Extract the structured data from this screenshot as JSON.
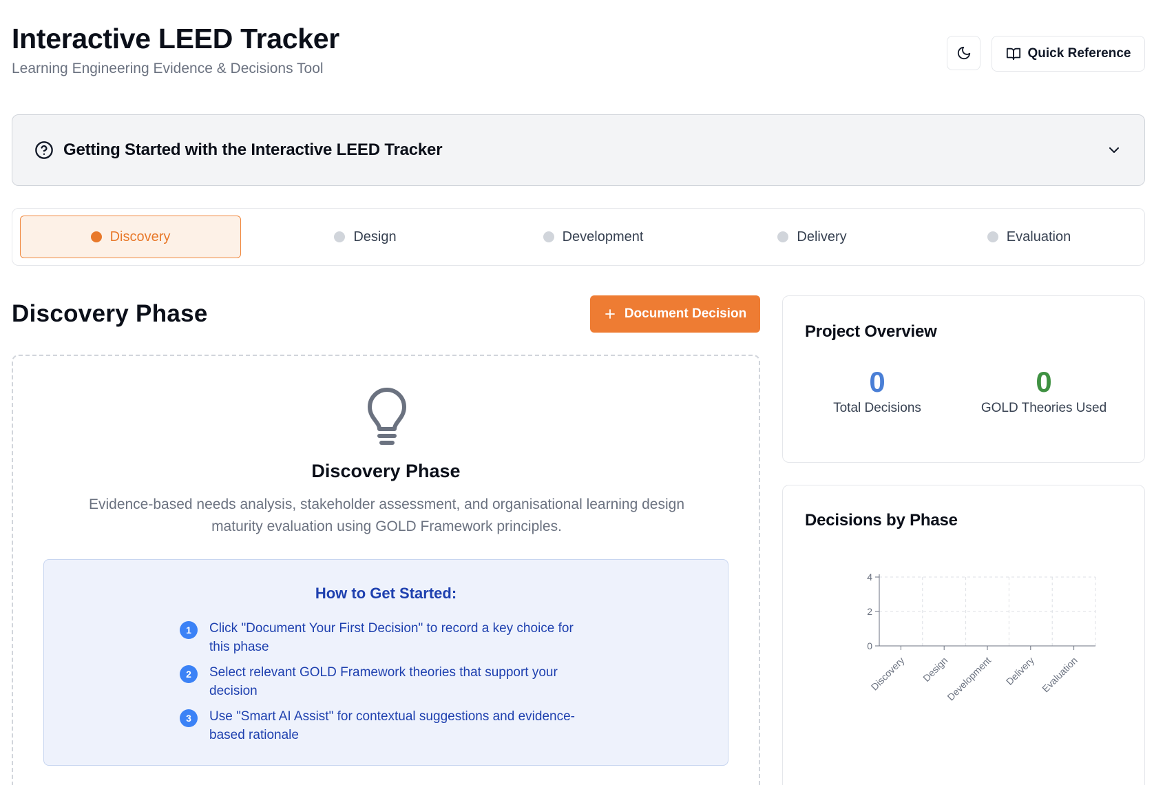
{
  "header": {
    "title": "Interactive LEED Tracker",
    "subtitle": "Learning Engineering Evidence & Decisions Tool",
    "theme_icon": "moon-icon",
    "quick_reference_label": "Quick Reference"
  },
  "getting_started": {
    "title": "Getting Started with the Interactive LEED Tracker",
    "icon": "help-circle-icon",
    "expand_icon": "chevron-down-icon"
  },
  "phase_tabs": [
    {
      "label": "Discovery",
      "active": true
    },
    {
      "label": "Design",
      "active": false
    },
    {
      "label": "Development",
      "active": false
    },
    {
      "label": "Delivery",
      "active": false
    },
    {
      "label": "Evaluation",
      "active": false
    }
  ],
  "main": {
    "phase_heading": "Discovery Phase",
    "document_button_label": "Document Decision",
    "card": {
      "icon": "lightbulb-icon",
      "title": "Discovery Phase",
      "description": "Evidence-based needs analysis, stakeholder assessment, and organisational learning design maturity evaluation using GOLD Framework principles.",
      "howto": {
        "title": "How to Get Started:",
        "steps": [
          {
            "num": "1",
            "text": "Click \"Document Your First Decision\" to record a key choice for this phase"
          },
          {
            "num": "2",
            "text": "Select relevant GOLD Framework theories that support your decision"
          },
          {
            "num": "3",
            "text": "Use \"Smart AI Assist\" for contextual suggestions and evidence-based rationale"
          }
        ]
      }
    }
  },
  "overview": {
    "title": "Project Overview",
    "total_decisions_value": "0",
    "total_decisions_label": "Total Decisions",
    "gold_theories_value": "0",
    "gold_theories_label": "GOLD Theories Used"
  },
  "colors": {
    "accent": "#ee7c33",
    "blue_stat": "#4a7fd6",
    "green_stat": "#3f9142"
  },
  "chart_data": {
    "type": "bar",
    "title": "Decisions by Phase",
    "categories": [
      "Discovery",
      "Design",
      "Development",
      "Delivery",
      "Evaluation"
    ],
    "values": [
      0,
      0,
      0,
      0,
      0
    ],
    "yticks": [
      0,
      2,
      4
    ],
    "ylim": [
      0,
      4
    ],
    "grid": true
  }
}
